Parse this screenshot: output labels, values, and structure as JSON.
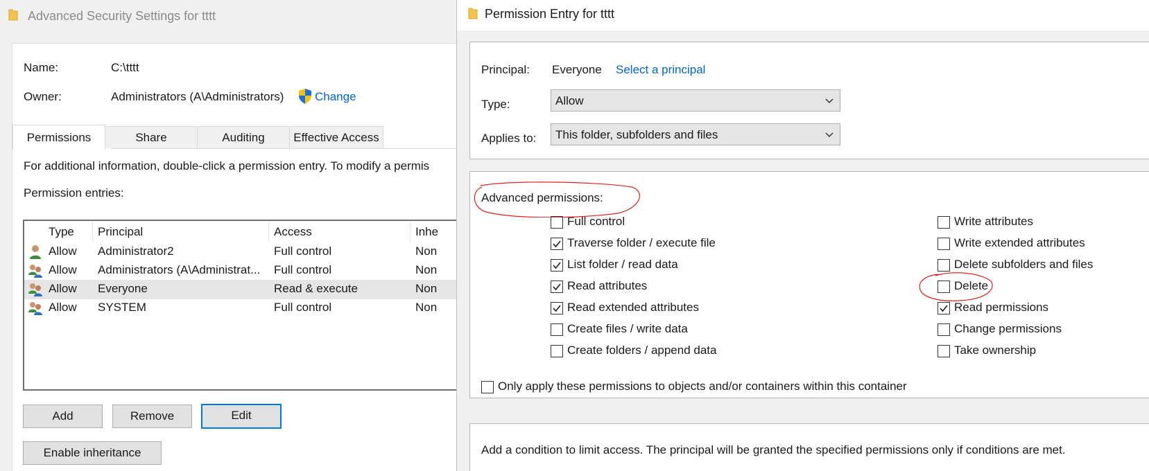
{
  "left_window": {
    "title": "Advanced Security Settings for tttt",
    "name_label": "Name:",
    "name_value": "C:\\tttt",
    "owner_label": "Owner:",
    "owner_value": "Administrators (A\\Administrators)",
    "change_link": "Change",
    "tabs": [
      "Permissions",
      "Share",
      "Auditing",
      "Effective Access"
    ],
    "active_tab": "Permissions",
    "info_text": "For additional information, double-click a permission entry. To modify a permis",
    "entries_label": "Permission entries:",
    "columns": [
      "Type",
      "Principal",
      "Access",
      "Inhe"
    ],
    "rows": [
      {
        "type": "Allow",
        "principal": "Administrator2",
        "access": "Full control",
        "inherited": "Non"
      },
      {
        "type": "Allow",
        "principal": "Administrators (A\\Administrat...",
        "access": "Full control",
        "inherited": "Non"
      },
      {
        "type": "Allow",
        "principal": "Everyone",
        "access": "Read & execute",
        "inherited": "Non"
      },
      {
        "type": "Allow",
        "principal": "SYSTEM",
        "access": "Full control",
        "inherited": "Non"
      }
    ],
    "selected_row": 2,
    "buttons": {
      "add": "Add",
      "remove": "Remove",
      "edit": "Edit",
      "inheritance": "Enable inheritance"
    }
  },
  "right_window": {
    "title": "Permission Entry for tttt",
    "principal_label": "Principal:",
    "principal_value": "Everyone",
    "select_principal_link": "Select a principal",
    "type_label": "Type:",
    "type_value": "Allow",
    "applies_label": "Applies to:",
    "applies_value": "This folder, subfolders and files",
    "advanced_label": "Advanced permissions:",
    "permissions_left": [
      {
        "label": "Full control",
        "checked": false
      },
      {
        "label": "Traverse folder / execute file",
        "checked": true
      },
      {
        "label": "List folder / read data",
        "checked": true
      },
      {
        "label": "Read attributes",
        "checked": true
      },
      {
        "label": "Read extended attributes",
        "checked": true
      },
      {
        "label": "Create files / write data",
        "checked": false
      },
      {
        "label": "Create folders / append data",
        "checked": false
      }
    ],
    "permissions_right": [
      {
        "label": "Write attributes",
        "checked": false
      },
      {
        "label": "Write extended attributes",
        "checked": false
      },
      {
        "label": "Delete subfolders and files",
        "checked": false
      },
      {
        "label": "Delete",
        "checked": false
      },
      {
        "label": "Read permissions",
        "checked": true
      },
      {
        "label": "Change permissions",
        "checked": false
      },
      {
        "label": "Take ownership",
        "checked": false
      }
    ],
    "only_apply_label": "Only apply these permissions to objects and/or containers within this container",
    "only_apply_checked": false,
    "condition_text": "Add a condition to limit access. The principal will be granted the specified permissions only if conditions are met."
  },
  "colors": {
    "link": "#0066cc",
    "focus_border": "#0078d7",
    "annotation": "#e02020",
    "folder": "#f2c44d"
  }
}
